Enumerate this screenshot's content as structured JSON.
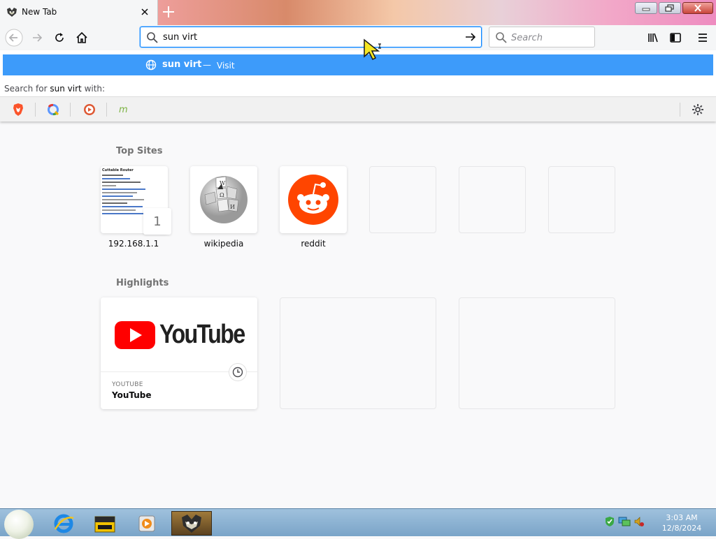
{
  "tab": {
    "title": "New Tab"
  },
  "navbar": {
    "url_value": "sun virt",
    "search_placeholder": "Search"
  },
  "dropdown": {
    "suggestion_query": "sun virt",
    "suggestion_separator": "—",
    "suggestion_action": "Visit",
    "search_with_prefix": "Search for",
    "search_with_query": "sun virt",
    "search_with_suffix": "with:",
    "engines": [
      "brave-icon",
      "qwant-icon",
      "duckduckgo-icon",
      "mojeek-icon"
    ]
  },
  "newtab": {
    "top_sites_title": "Top Sites",
    "top_sites": [
      {
        "label": "192.168.1.1",
        "pin_number": "1"
      },
      {
        "label": "wikipedia"
      },
      {
        "label": "reddit"
      }
    ],
    "highlights_title": "Highlights",
    "highlights": [
      {
        "host": "YOUTUBE",
        "title": "YouTube",
        "logo_text": "YouTube"
      }
    ]
  },
  "thumbnail_lines": {
    "heading": "Cuttable Router"
  },
  "taskbar": {
    "time": "3:03 AM",
    "date": "12/8/2024"
  },
  "colors": {
    "accent": "#0a84ff",
    "suggestion_bg": "#3d9bfa",
    "reddit": "#ff4500",
    "youtube_red": "#ff0000"
  }
}
